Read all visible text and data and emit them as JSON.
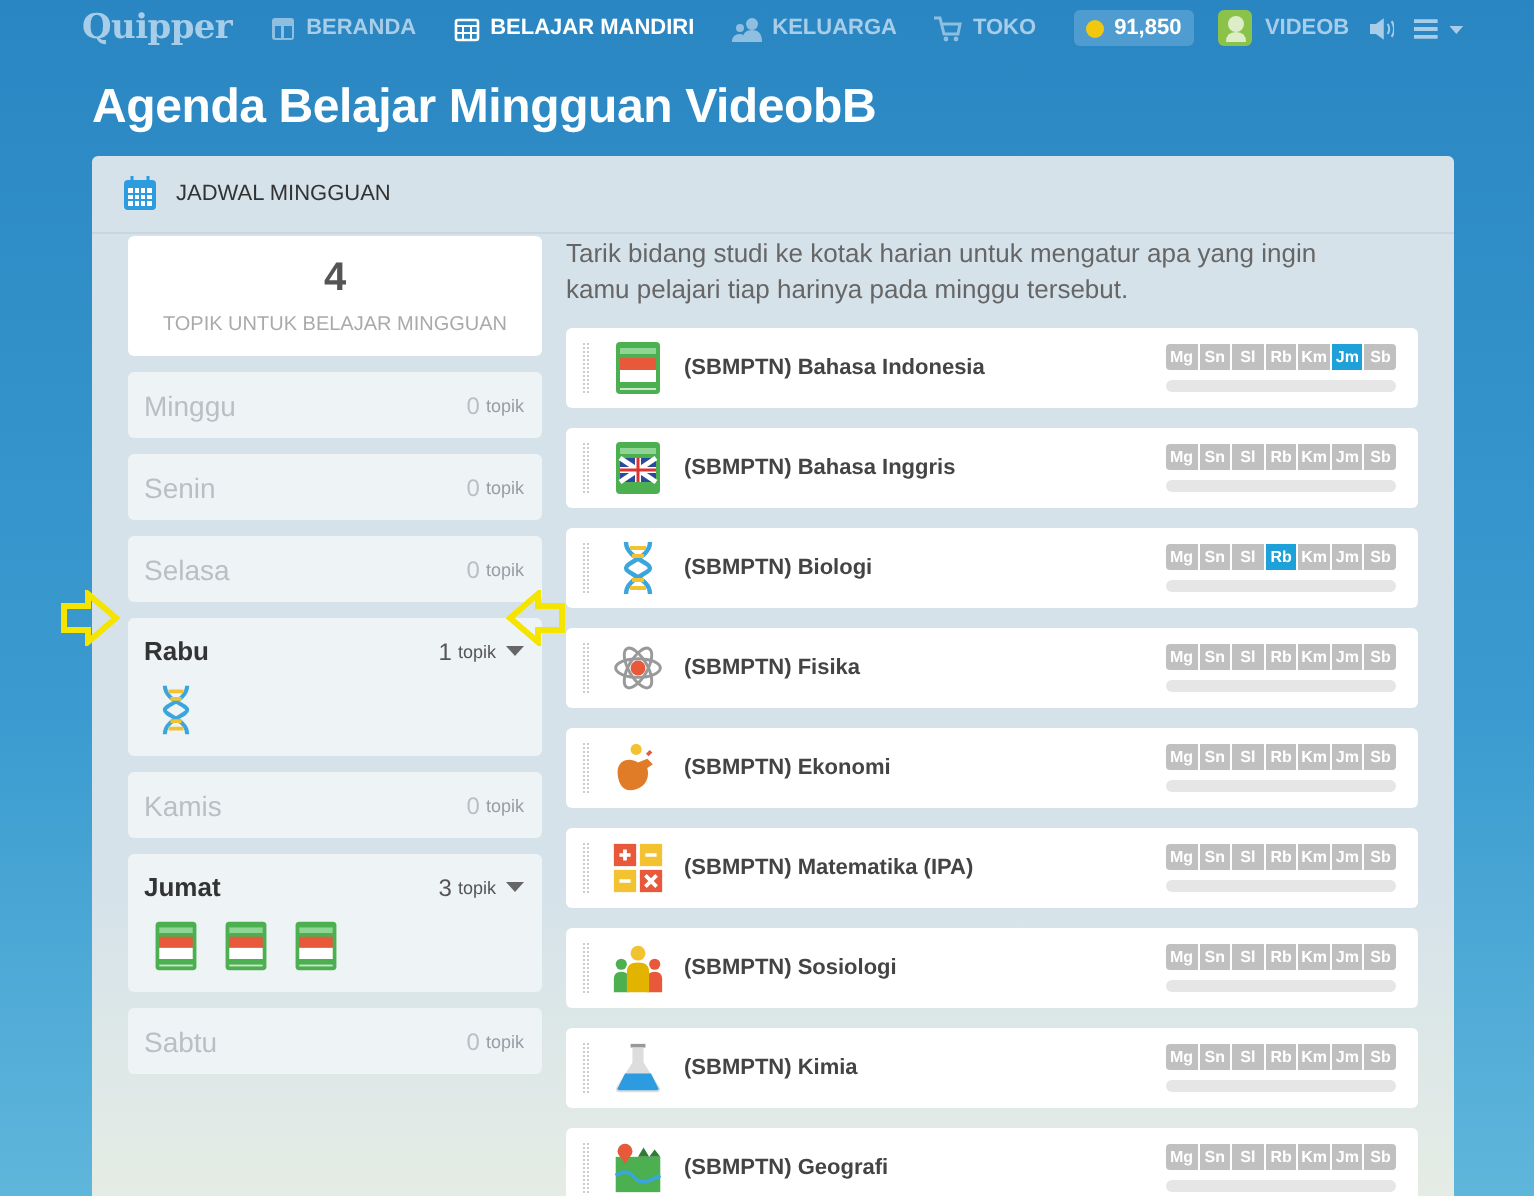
{
  "nav": {
    "logo": "Quipper",
    "items": [
      {
        "label": "BERANDA",
        "selected": false
      },
      {
        "label": "BELAJAR MANDIRI",
        "selected": true
      },
      {
        "label": "KELUARGA",
        "selected": false
      },
      {
        "label": "TOKO",
        "selected": false
      }
    ],
    "coins": "91,850",
    "user": "VIDEOB"
  },
  "title": "Agenda Belajar Mingguan VideobB",
  "panel": {
    "heading": "JADWAL MINGGUAN",
    "summary": {
      "count": "4",
      "label": "TOPIK UNTUK BELAJAR MINGGUAN"
    },
    "days": [
      {
        "name": "Minggu",
        "count": "0",
        "unit": "topik",
        "expanded": false
      },
      {
        "name": "Senin",
        "count": "0",
        "unit": "topik",
        "expanded": false
      },
      {
        "name": "Selasa",
        "count": "0",
        "unit": "topik",
        "expanded": false
      },
      {
        "name": "Rabu",
        "count": "1",
        "unit": "topik",
        "expanded": true,
        "topics": [
          {
            "kind": "biology"
          }
        ]
      },
      {
        "name": "Kamis",
        "count": "0",
        "unit": "topik",
        "expanded": false
      },
      {
        "name": "Jumat",
        "count": "3",
        "unit": "topik",
        "expanded": true,
        "topics": [
          {
            "kind": "indonesian"
          },
          {
            "kind": "indonesian"
          },
          {
            "kind": "indonesian"
          }
        ]
      },
      {
        "name": "Sabtu",
        "count": "0",
        "unit": "topik",
        "expanded": false
      }
    ],
    "intro": "Tarik bidang studi ke kotak harian untuk mengatur apa yang ingin kamu pelajari tiap harinya pada minggu tersebut.",
    "subjects": [
      {
        "name": "(SBMPTN) Bahasa Indonesia",
        "kind": "indonesian",
        "level": 0,
        "days": [
          {
            "label": "Mg",
            "selected": false
          },
          {
            "label": "Sn",
            "selected": false
          },
          {
            "label": "Sl",
            "selected": false
          },
          {
            "label": "Rb",
            "selected": false
          },
          {
            "label": "Km",
            "selected": false
          },
          {
            "label": "Jm",
            "selected": true
          },
          {
            "label": "Sb",
            "selected": false
          }
        ]
      },
      {
        "name": "(SBMPTN) Bahasa Inggris",
        "kind": "english",
        "level": 0,
        "days": [
          {
            "label": "Mg",
            "selected": false
          },
          {
            "label": "Sn",
            "selected": false
          },
          {
            "label": "Sl",
            "selected": false
          },
          {
            "label": "Rb",
            "selected": false
          },
          {
            "label": "Km",
            "selected": false
          },
          {
            "label": "Jm",
            "selected": false
          },
          {
            "label": "Sb",
            "selected": false
          }
        ]
      },
      {
        "name": "(SBMPTN) Biologi",
        "kind": "biology",
        "level": 0,
        "days": [
          {
            "label": "Mg",
            "selected": false
          },
          {
            "label": "Sn",
            "selected": false
          },
          {
            "label": "Sl",
            "selected": false
          },
          {
            "label": "Rb",
            "selected": true
          },
          {
            "label": "Km",
            "selected": false
          },
          {
            "label": "Jm",
            "selected": false
          },
          {
            "label": "Sb",
            "selected": false
          }
        ]
      },
      {
        "name": "(SBMPTN) Fisika",
        "kind": "physics",
        "level": 0,
        "days": [
          {
            "label": "Mg",
            "selected": false
          },
          {
            "label": "Sn",
            "selected": false
          },
          {
            "label": "Sl",
            "selected": false
          },
          {
            "label": "Rb",
            "selected": false
          },
          {
            "label": "Km",
            "selected": false
          },
          {
            "label": "Jm",
            "selected": false
          },
          {
            "label": "Sb",
            "selected": false
          }
        ]
      },
      {
        "name": "(SBMPTN) Ekonomi",
        "kind": "economics",
        "level": 0,
        "days": [
          {
            "label": "Mg",
            "selected": false
          },
          {
            "label": "Sn",
            "selected": false
          },
          {
            "label": "Sl",
            "selected": false
          },
          {
            "label": "Rb",
            "selected": false
          },
          {
            "label": "Km",
            "selected": false
          },
          {
            "label": "Jm",
            "selected": false
          },
          {
            "label": "Sb",
            "selected": false
          }
        ]
      },
      {
        "name": "(SBMPTN) Matematika (IPA)",
        "kind": "math",
        "level": 0,
        "days": [
          {
            "label": "Mg",
            "selected": false
          },
          {
            "label": "Sn",
            "selected": false
          },
          {
            "label": "Sl",
            "selected": false
          },
          {
            "label": "Rb",
            "selected": false
          },
          {
            "label": "Km",
            "selected": false
          },
          {
            "label": "Jm",
            "selected": false
          },
          {
            "label": "Sb",
            "selected": false
          }
        ]
      },
      {
        "name": "(SBMPTN) Sosiologi",
        "kind": "sociology",
        "level": 0,
        "days": [
          {
            "label": "Mg",
            "selected": false
          },
          {
            "label": "Sn",
            "selected": false
          },
          {
            "label": "Sl",
            "selected": false
          },
          {
            "label": "Rb",
            "selected": false
          },
          {
            "label": "Km",
            "selected": false
          },
          {
            "label": "Jm",
            "selected": false
          },
          {
            "label": "Sb",
            "selected": false
          }
        ]
      },
      {
        "name": "(SBMPTN) Kimia",
        "kind": "chemistry",
        "level": 0,
        "days": [
          {
            "label": "Mg",
            "selected": false
          },
          {
            "label": "Sn",
            "selected": false
          },
          {
            "label": "Sl",
            "selected": false
          },
          {
            "label": "Rb",
            "selected": false
          },
          {
            "label": "Km",
            "selected": false
          },
          {
            "label": "Jm",
            "selected": false
          },
          {
            "label": "Sb",
            "selected": false
          }
        ]
      },
      {
        "name": "(SBMPTN) Geografi",
        "kind": "geography",
        "level": 0,
        "days": [
          {
            "label": "Mg",
            "selected": false
          },
          {
            "label": "Sn",
            "selected": false
          },
          {
            "label": "Sl",
            "selected": false
          },
          {
            "label": "Rb",
            "selected": false
          },
          {
            "label": "Km",
            "selected": false
          },
          {
            "label": "Jm",
            "selected": false
          },
          {
            "label": "Sb",
            "selected": false
          }
        ]
      }
    ]
  }
}
